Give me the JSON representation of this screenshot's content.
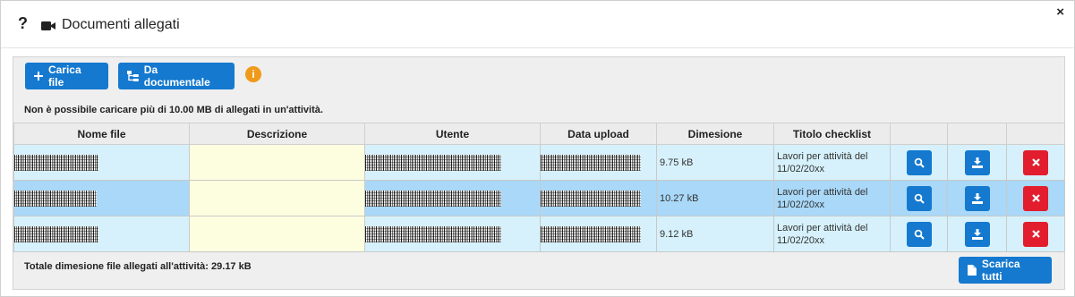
{
  "header": {
    "help": "?",
    "title": "Documenti allegati",
    "close": "×"
  },
  "toolbar": {
    "upload_label": "Carica file",
    "doc_label": "Da documentale",
    "info": "i"
  },
  "notice": "Non è possibile caricare più di 10.00 MB di allegati in un'attività.",
  "table": {
    "columns": [
      "Nome file",
      "Descrizione",
      "Utente",
      "Data upload",
      "Dimesione",
      "Titolo checklist",
      "",
      "",
      ""
    ],
    "rows": [
      {
        "size": "9.75 kB",
        "checklist": "Lavori per attività del 11/02/20xx"
      },
      {
        "size": "10.27 kB",
        "checklist": "Lavori per attività del 11/02/20xx"
      },
      {
        "size": "9.12 kB",
        "checklist": "Lavori per attività del 11/02/20xx"
      }
    ]
  },
  "footer": {
    "total": "Totale dimesione file allegati all'attività: 29.17 kB",
    "download_all": "Scarica tutti"
  },
  "colors": {
    "accent": "#1479cf",
    "danger": "#e21d2d",
    "info": "#f09a19"
  }
}
